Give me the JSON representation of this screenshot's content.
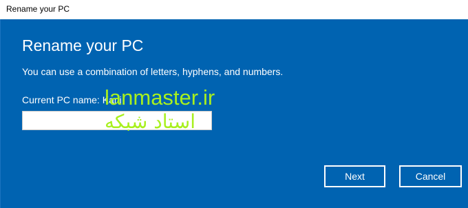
{
  "window": {
    "title": "Rename your PC"
  },
  "dialog": {
    "heading": "Rename your PC",
    "description": "You can use a combination of letters, hyphens, and numbers.",
    "current_name_label": "Current PC name: Kani",
    "name_input": {
      "value": "",
      "placeholder": ""
    }
  },
  "watermark": {
    "latin": "lanmaster.ir",
    "persian": "استاد شبکه"
  },
  "buttons": {
    "next_label": "Next",
    "cancel_label": "Cancel"
  },
  "colors": {
    "panel_background": "#0063b1",
    "text": "#ffffff",
    "watermark": "#a8f01e"
  }
}
